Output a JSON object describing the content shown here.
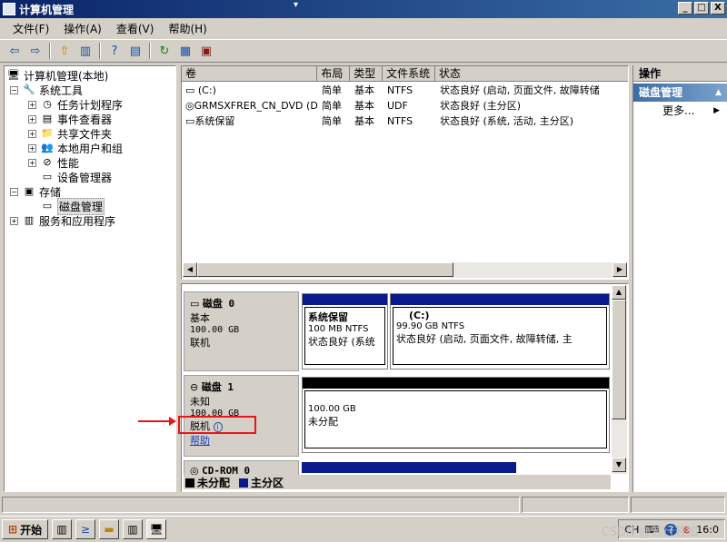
{
  "window": {
    "title": "计算机管理",
    "controls": [
      "_",
      "□",
      "X"
    ]
  },
  "menu": [
    "文件(F)",
    "操作(A)",
    "查看(V)",
    "帮助(H)"
  ],
  "tree": {
    "items": [
      {
        "label": "计算机管理(本地)",
        "toggle": "",
        "icon": "computer-icon",
        "glyph": "🖥"
      },
      {
        "label": "系统工具",
        "toggle": "−",
        "icon": "tools-icon",
        "glyph": "🔧"
      },
      {
        "label": "任务计划程序",
        "toggle": "+",
        "icon": "clock-icon",
        "glyph": "◷"
      },
      {
        "label": "事件查看器",
        "toggle": "+",
        "icon": "event-viewer-icon",
        "glyph": "▤"
      },
      {
        "label": "共享文件夹",
        "toggle": "+",
        "icon": "shared-folder-icon",
        "glyph": "📁"
      },
      {
        "label": "本地用户和组",
        "toggle": "+",
        "icon": "users-icon",
        "glyph": "👥"
      },
      {
        "label": "性能",
        "toggle": "+",
        "icon": "performance-icon",
        "glyph": "⊘"
      },
      {
        "label": "设备管理器",
        "toggle": "",
        "icon": "device-manager-icon",
        "glyph": "▭"
      },
      {
        "label": "存储",
        "toggle": "−",
        "icon": "storage-icon",
        "glyph": "▣"
      },
      {
        "label": "磁盘管理",
        "toggle": "",
        "icon": "disk-management-icon",
        "glyph": "▭"
      },
      {
        "label": "服务和应用程序",
        "toggle": "+",
        "icon": "services-icon",
        "glyph": "▥"
      }
    ]
  },
  "volumes": {
    "columns": [
      "卷",
      "布局",
      "类型",
      "文件系统",
      "状态"
    ],
    "rows": [
      {
        "name": "(C:)",
        "layout": "简单",
        "type": "基本",
        "fs": "NTFS",
        "status": "状态良好 (启动, 页面文件, 故障转储"
      },
      {
        "name": "GRMSXFRER_CN_DVD (D:)",
        "layout": "简单",
        "type": "基本",
        "fs": "UDF",
        "status": "状态良好 (主分区)"
      },
      {
        "name": "系统保留",
        "layout": "简单",
        "type": "基本",
        "fs": "NTFS",
        "status": "状态良好 (系统, 活动, 主分区)"
      }
    ]
  },
  "disks": [
    {
      "name": "磁盘 0",
      "kind": "基本",
      "size": "100.00 GB",
      "state": "联机",
      "partitions": [
        {
          "name": "系统保留",
          "detail": "100 MB NTFS",
          "status": "状态良好 (系统"
        },
        {
          "name": "(C:)",
          "detail": "99.90 GB NTFS",
          "status": "状态良好 (启动, 页面文件, 故障转储, 主"
        }
      ]
    },
    {
      "name": "磁盘 1",
      "kind": "未知",
      "size": "100.00 GB",
      "state": "脱机",
      "help": "帮助",
      "partitions": [
        {
          "name": "",
          "detail": "100.00 GB",
          "status": "未分配"
        }
      ]
    },
    {
      "name": "CD-ROM 0"
    }
  ],
  "legend": [
    {
      "label": "未分配",
      "color": "#000000"
    },
    {
      "label": "主分区",
      "color": "#0a1a8a"
    }
  ],
  "actions": {
    "header": "操作",
    "section": "磁盘管理",
    "more": "更多..."
  },
  "taskbar": {
    "start": "开始",
    "tray_lang": "CH",
    "clock": "16:0"
  },
  "watermark": "CSDN @若行若知"
}
